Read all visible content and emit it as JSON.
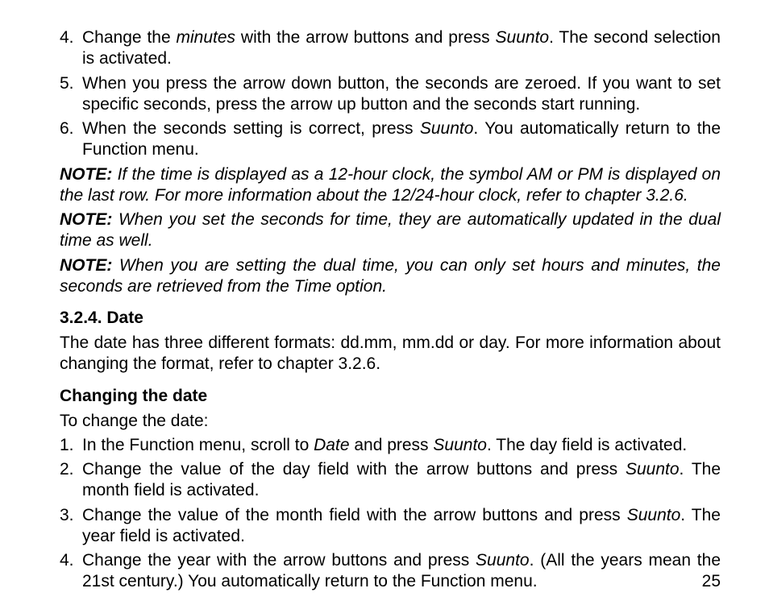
{
  "topList": {
    "start": 4,
    "items": [
      {
        "num": "4.",
        "segments": [
          {
            "t": "Change the "
          },
          {
            "t": "minutes",
            "i": true
          },
          {
            "t": " with the arrow buttons and press "
          },
          {
            "t": "Suunto",
            "i": true
          },
          {
            "t": ". The second selection is activated."
          }
        ]
      },
      {
        "num": "5.",
        "segments": [
          {
            "t": "When you press the arrow down button, the seconds are zeroed. If you want to set specific seconds, press the arrow up button and the seconds start running."
          }
        ]
      },
      {
        "num": "6.",
        "segments": [
          {
            "t": "When the seconds setting is correct, press "
          },
          {
            "t": "Suunto",
            "i": true
          },
          {
            "t": ". You automatically return to the Function menu."
          }
        ]
      }
    ]
  },
  "notes": [
    {
      "label": "NOTE:",
      "text": " If the time is displayed as a 12-hour clock, the symbol AM or PM is displayed on the last row. For more information about the 12/24-hour clock, refer to chapter 3.2.6."
    },
    {
      "label": "NOTE:",
      "text": " When you set the seconds for time, they are automatically updated in the dual time as well."
    },
    {
      "label": "NOTE:",
      "text": " When you are setting the dual time, you can only set hours and minutes, the seconds are retrieved from the Time option."
    }
  ],
  "section": {
    "heading": "3.2.4. Date",
    "intro": "The date has three different formats: dd.mm, mm.dd or day. For more information about changing the format,  refer to chapter 3.2.6.",
    "subheading": "Changing the date",
    "lead": "To change the date:",
    "list": {
      "items": [
        {
          "num": "1.",
          "segments": [
            {
              "t": "In the Function menu, scroll to "
            },
            {
              "t": "Date",
              "i": true
            },
            {
              "t": " and press "
            },
            {
              "t": "Suunto",
              "i": true
            },
            {
              "t": ". The day field is activated."
            }
          ]
        },
        {
          "num": "2.",
          "segments": [
            {
              "t": "Change the value of the day field with the arrow buttons and press "
            },
            {
              "t": "Suunto",
              "i": true
            },
            {
              "t": ". The month field is activated."
            }
          ]
        },
        {
          "num": "3.",
          "segments": [
            {
              "t": "Change the value of the month field with the arrow buttons and press "
            },
            {
              "t": "Suunto",
              "i": true
            },
            {
              "t": ". The year field is activated."
            }
          ]
        },
        {
          "num": "4.",
          "segments": [
            {
              "t": "Change the year with the arrow buttons and press "
            },
            {
              "t": "Suunto",
              "i": true
            },
            {
              "t": ". (All the years mean the 21st century.) You automatically return to the Function menu."
            }
          ]
        }
      ]
    }
  },
  "pageNumber": "25"
}
